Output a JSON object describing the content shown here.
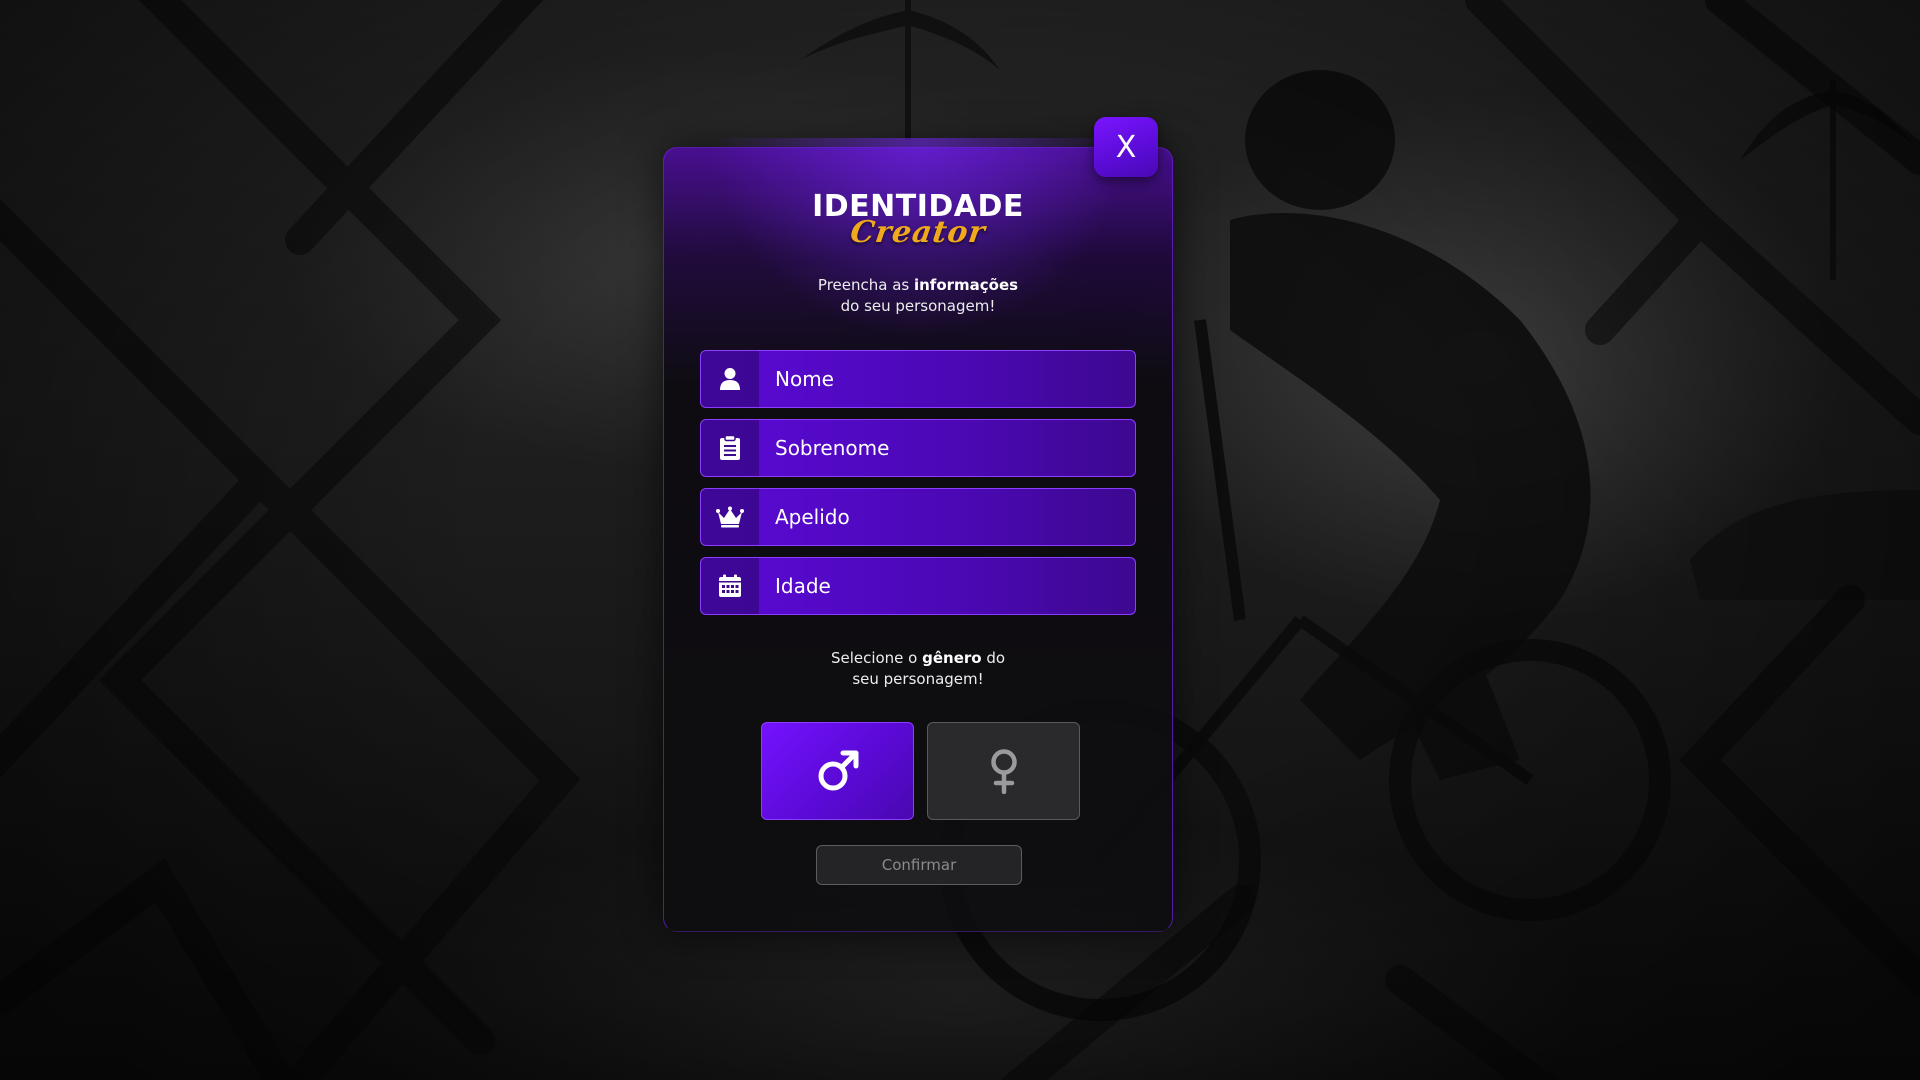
{
  "title": {
    "main": "IDENTIDADE",
    "sub": "Creator"
  },
  "close_label": "X",
  "info": {
    "line1_prefix": "Preencha as ",
    "line1_bold": "informações",
    "line2": "do seu personagem!"
  },
  "fields": [
    {
      "icon": "user-icon",
      "placeholder": "Nome"
    },
    {
      "icon": "clipboard-icon",
      "placeholder": "Sobrenome"
    },
    {
      "icon": "crown-icon",
      "placeholder": "Apelido"
    },
    {
      "icon": "calendar-icon",
      "placeholder": "Idade"
    }
  ],
  "gender": {
    "prompt_prefix": "Selecione o ",
    "prompt_bold": "gênero",
    "prompt_suffix": " do",
    "prompt_line2": "seu personagem!",
    "selected": "male",
    "male_icon": "male-symbol-icon",
    "female_icon": "female-symbol-icon"
  },
  "confirm_label": "Confirmar",
  "colors": {
    "accent": "#5b0ad6",
    "accent_light": "#7512ff",
    "title_gold": "#f0a81c",
    "inactive": "#2a2a2c"
  }
}
